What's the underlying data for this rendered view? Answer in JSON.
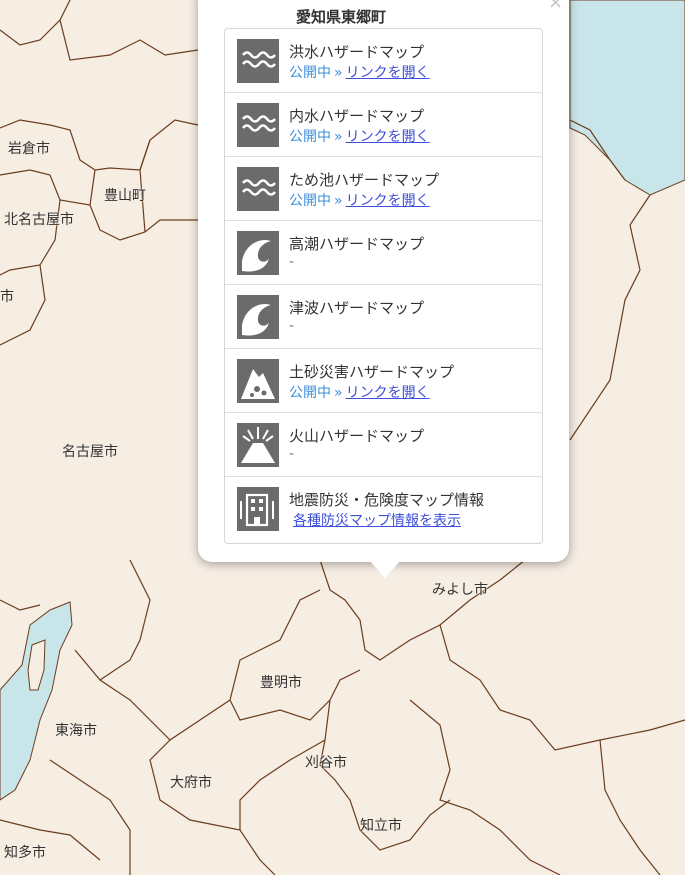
{
  "popup": {
    "title": "愛知県東郷町",
    "close_label": "×",
    "items": [
      {
        "name": "洪水ハザードマップ",
        "icon": "flood-wave-icon",
        "status": "公開中",
        "sep": "»",
        "link": "リンクを開く"
      },
      {
        "name": "内水ハザードマップ",
        "icon": "inland-flood-wave-icon",
        "status": "公開中",
        "sep": "»",
        "link": "リンクを開く"
      },
      {
        "name": "ため池ハザードマップ",
        "icon": "reservoir-wave-icon",
        "status": "公開中",
        "sep": "»",
        "link": "リンクを開く"
      },
      {
        "name": "高潮ハザードマップ",
        "icon": "storm-surge-icon",
        "sub": "-"
      },
      {
        "name": "津波ハザードマップ",
        "icon": "tsunami-icon",
        "sub": "-"
      },
      {
        "name": "土砂災害ハザードマップ",
        "icon": "landslide-icon",
        "status": "公開中",
        "sep": "»",
        "link": "リンクを開く"
      },
      {
        "name": "火山ハザードマップ",
        "icon": "volcano-icon",
        "sub": "-"
      },
      {
        "name": "地震防災・危険度マップ情報",
        "icon": "earthquake-building-icon",
        "link": "各種防災マップ情報を表示"
      }
    ]
  },
  "map": {
    "cities": [
      "岩倉市",
      "豊山町",
      "北名古屋市",
      "市",
      "名古屋市",
      "みよし市",
      "豊明市",
      "東海市",
      "大府市",
      "刈谷市",
      "知立市",
      "知多市"
    ]
  },
  "colors": {
    "land": "#f6ede3",
    "water": "#c8e6ea",
    "border": "#6b3d1e",
    "link": "#3f4fd8",
    "status": "#3f8fd8",
    "icon_bg": "#6b6b6b"
  }
}
